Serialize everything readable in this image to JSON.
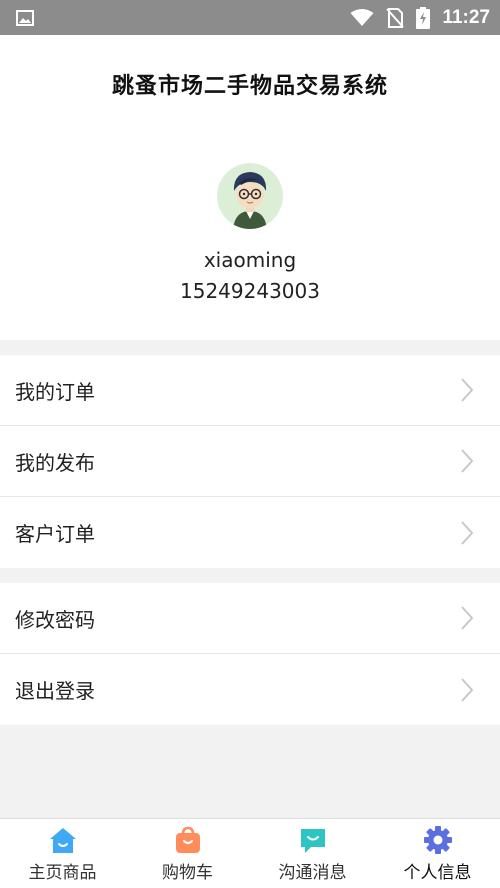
{
  "status_bar": {
    "time": "11:27",
    "icons": [
      "gallery-icon",
      "wifi-icon",
      "no-sim-icon",
      "battery-charging-icon"
    ]
  },
  "header": {
    "title": "跳蚤市场二手物品交易系统"
  },
  "profile": {
    "username": "xiaoming",
    "phone": "15249243003"
  },
  "menu": {
    "group1": [
      {
        "label": "我的订单"
      },
      {
        "label": "我的发布"
      },
      {
        "label": "客户订单"
      }
    ],
    "group2": [
      {
        "label": "修改密码"
      },
      {
        "label": "退出登录"
      }
    ]
  },
  "bottom_nav": {
    "items": [
      {
        "label": "主页商品",
        "icon": "home-icon",
        "color": "#3fa9f5"
      },
      {
        "label": "购物车",
        "icon": "shopping-bag-icon",
        "color": "#ff8c5a"
      },
      {
        "label": "沟通消息",
        "icon": "message-icon",
        "color": "#2ec4c4"
      },
      {
        "label": "个人信息",
        "icon": "gear-icon",
        "color": "#5b6fe0"
      }
    ],
    "active_index": 3
  }
}
